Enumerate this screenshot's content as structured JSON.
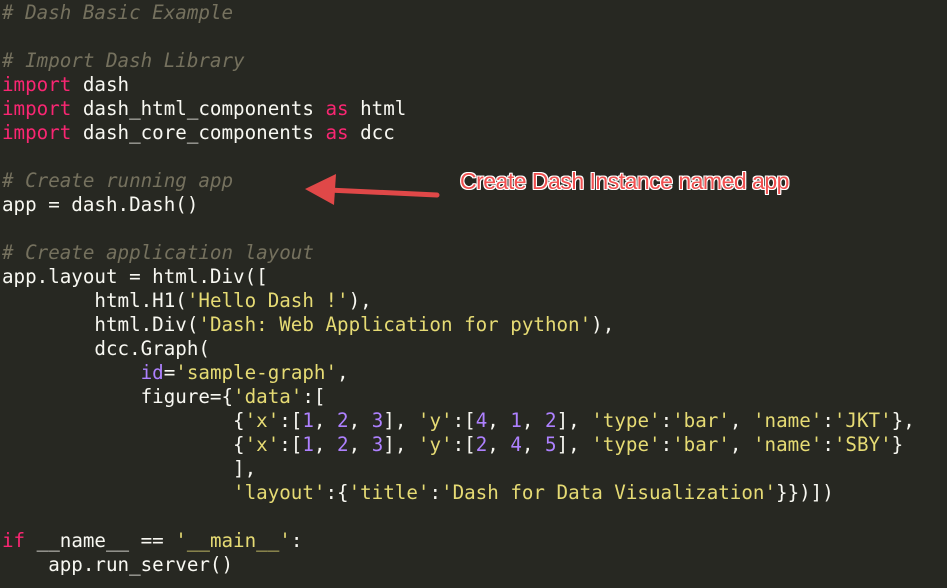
{
  "colors": {
    "background": "#272822",
    "plain": "#f8f8f2",
    "comment": "#75715e",
    "keyword": "#f92672",
    "string": "#e6db74",
    "number": "#ae81ff",
    "param": "#ae81ff",
    "annotation": "#f05050"
  },
  "code": {
    "lines": [
      [
        [
          "comment",
          "# Dash Basic Example"
        ]
      ],
      [],
      [
        [
          "comment",
          "# Import Dash Library"
        ]
      ],
      [
        [
          "keyword",
          "import"
        ],
        [
          "plain",
          " dash"
        ]
      ],
      [
        [
          "keyword",
          "import"
        ],
        [
          "plain",
          " dash_html_components "
        ],
        [
          "keyword",
          "as"
        ],
        [
          "plain",
          " html"
        ]
      ],
      [
        [
          "keyword",
          "import"
        ],
        [
          "plain",
          " dash_core_components "
        ],
        [
          "keyword",
          "as"
        ],
        [
          "plain",
          " dcc"
        ]
      ],
      [],
      [
        [
          "comment",
          "# Create running app"
        ]
      ],
      [
        [
          "plain",
          "app = dash.Dash()"
        ]
      ],
      [],
      [
        [
          "comment",
          "# Create application layout"
        ]
      ],
      [
        [
          "plain",
          "app.layout = html.Div(["
        ]
      ],
      [
        [
          "plain",
          "        html.H1("
        ],
        [
          "string",
          "'Hello Dash !'"
        ],
        [
          "plain",
          "),"
        ]
      ],
      [
        [
          "plain",
          "        html.Div("
        ],
        [
          "string",
          "'Dash: Web Application for python'"
        ],
        [
          "plain",
          "),"
        ]
      ],
      [
        [
          "plain",
          "        dcc.Graph("
        ]
      ],
      [
        [
          "plain",
          "            "
        ],
        [
          "param",
          "id"
        ],
        [
          "plain",
          "="
        ],
        [
          "string",
          "'sample-graph'"
        ],
        [
          "plain",
          ","
        ]
      ],
      [
        [
          "plain",
          "            figure={"
        ],
        [
          "string",
          "'data'"
        ],
        [
          "plain",
          ":["
        ]
      ],
      [
        [
          "plain",
          "                    {"
        ],
        [
          "string",
          "'x'"
        ],
        [
          "plain",
          ":["
        ],
        [
          "number",
          "1"
        ],
        [
          "plain",
          ", "
        ],
        [
          "number",
          "2"
        ],
        [
          "plain",
          ", "
        ],
        [
          "number",
          "3"
        ],
        [
          "plain",
          "], "
        ],
        [
          "string",
          "'y'"
        ],
        [
          "plain",
          ":["
        ],
        [
          "number",
          "4"
        ],
        [
          "plain",
          ", "
        ],
        [
          "number",
          "1"
        ],
        [
          "plain",
          ", "
        ],
        [
          "number",
          "2"
        ],
        [
          "plain",
          "], "
        ],
        [
          "string",
          "'type'"
        ],
        [
          "plain",
          ":"
        ],
        [
          "string",
          "'bar'"
        ],
        [
          "plain",
          ", "
        ],
        [
          "string",
          "'name'"
        ],
        [
          "plain",
          ":"
        ],
        [
          "string",
          "'JKT'"
        ],
        [
          "plain",
          "},"
        ]
      ],
      [
        [
          "plain",
          "                    {"
        ],
        [
          "string",
          "'x'"
        ],
        [
          "plain",
          ":["
        ],
        [
          "number",
          "1"
        ],
        [
          "plain",
          ", "
        ],
        [
          "number",
          "2"
        ],
        [
          "plain",
          ", "
        ],
        [
          "number",
          "3"
        ],
        [
          "plain",
          "], "
        ],
        [
          "string",
          "'y'"
        ],
        [
          "plain",
          ":["
        ],
        [
          "number",
          "2"
        ],
        [
          "plain",
          ", "
        ],
        [
          "number",
          "4"
        ],
        [
          "plain",
          ", "
        ],
        [
          "number",
          "5"
        ],
        [
          "plain",
          "], "
        ],
        [
          "string",
          "'type'"
        ],
        [
          "plain",
          ":"
        ],
        [
          "string",
          "'bar'"
        ],
        [
          "plain",
          ", "
        ],
        [
          "string",
          "'name'"
        ],
        [
          "plain",
          ":"
        ],
        [
          "string",
          "'SBY'"
        ],
        [
          "plain",
          "}"
        ]
      ],
      [
        [
          "plain",
          "                    ],"
        ]
      ],
      [
        [
          "plain",
          "                    "
        ],
        [
          "string",
          "'layout'"
        ],
        [
          "plain",
          ":{"
        ],
        [
          "string",
          "'title'"
        ],
        [
          "plain",
          ":"
        ],
        [
          "string",
          "'Dash for Data Visualization'"
        ],
        [
          "plain",
          "}})])"
        ]
      ],
      [],
      [
        [
          "keyword",
          "if"
        ],
        [
          "plain",
          " __name__ == "
        ],
        [
          "string",
          "'__main__'"
        ],
        [
          "plain",
          ":"
        ]
      ],
      [
        [
          "plain",
          "    app.run_server()"
        ]
      ]
    ]
  },
  "annotation": {
    "text": "Create Dash Instance named app",
    "points_to_line": 8
  }
}
